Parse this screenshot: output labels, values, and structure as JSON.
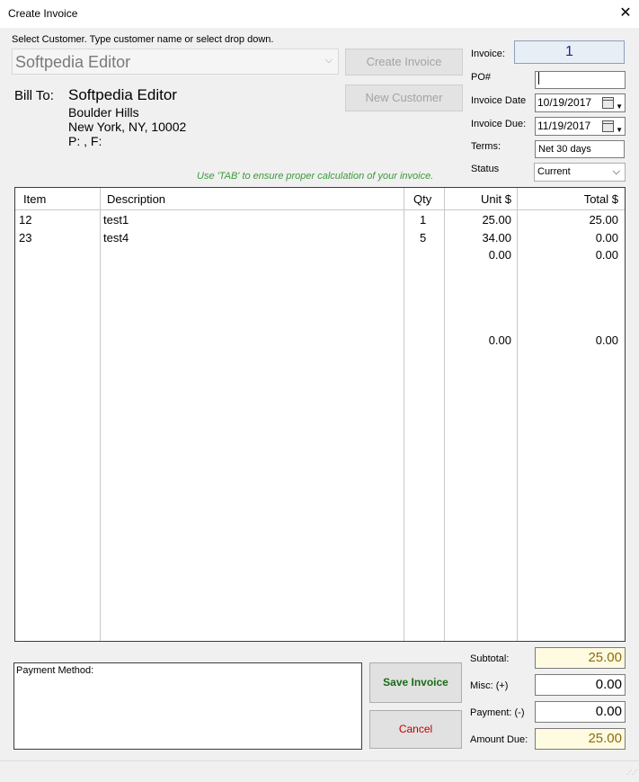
{
  "window": {
    "title": "Create Invoice",
    "close_glyph": "✕"
  },
  "customer": {
    "instruction": "Select Customer. Type customer name or select drop down.",
    "selected": "Softpedia Editor",
    "dropdown_glyph": "⌵"
  },
  "buttons": {
    "create_invoice": "Create Invoice",
    "new_customer": "New Customer",
    "save_invoice": "Save Invoice",
    "cancel": "Cancel"
  },
  "bill_to": {
    "label": "Bill To:",
    "name": "Softpedia Editor",
    "address1": "Boulder Hills",
    "address2": "New York, NY, 10002",
    "phone_fax": "P: , F:"
  },
  "hint": "Use 'TAB' to ensure proper calculation of your invoice.",
  "invoice": {
    "invoice_label": "Invoice:",
    "invoice_number": "1",
    "po_label": "PO#",
    "po_value": "",
    "date_label": "Invoice Date",
    "date_value": "10/19/2017",
    "due_label": "Invoice Due:",
    "due_value": "11/19/2017",
    "terms_label": "Terms:",
    "terms_value": "Net 30 days",
    "status_label": "Status",
    "status_value": "Current"
  },
  "table": {
    "headers": {
      "item": "Item",
      "description": "Description",
      "qty": "Qty",
      "unit": "Unit $",
      "total": "Total $"
    },
    "rows": [
      {
        "item": "12",
        "description": "test1",
        "qty": "1",
        "unit": "25.00",
        "total": "25.00"
      },
      {
        "item": "23",
        "description": "test4",
        "qty": "5",
        "unit": "34.00",
        "total": "0.00"
      },
      {
        "item": "",
        "description": "",
        "qty": "",
        "unit": "0.00",
        "total": "0.00"
      },
      {
        "item": "",
        "description": "",
        "qty": "",
        "unit": "0.00",
        "total": "0.00"
      }
    ]
  },
  "payment": {
    "label": "Payment Method:"
  },
  "totals": {
    "subtotal_label": "Subtotal:",
    "subtotal": "25.00",
    "misc_label": "Misc: (+)",
    "misc": "0.00",
    "payment_label": "Payment: (-)",
    "payment": "0.00",
    "amount_due_label": "Amount Due:",
    "amount_due": "25.00"
  },
  "colors": {
    "save_text": "#1a6b1a",
    "cancel_text": "#c00000",
    "hint_text": "#3a9a3a",
    "total_highlight": "#fffbe1"
  }
}
